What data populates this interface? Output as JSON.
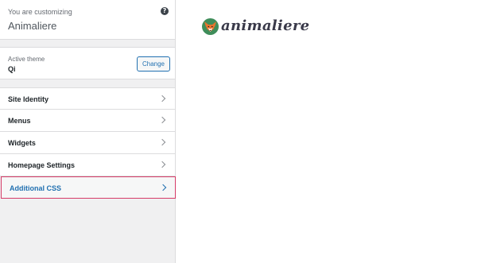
{
  "customize": {
    "action_text": "You are customizing",
    "site_title": "Animaliere",
    "help_icon_glyph": "?"
  },
  "theme": {
    "label": "Active theme",
    "name": "Qi",
    "change_label": "Change"
  },
  "menu": {
    "items": [
      {
        "label": "Site Identity"
      },
      {
        "label": "Menus"
      },
      {
        "label": "Widgets"
      },
      {
        "label": "Homepage Settings"
      },
      {
        "label": "Additional CSS",
        "active": true
      }
    ]
  },
  "preview": {
    "logo_text": "animaliere",
    "logo_icon": "fox-face-icon"
  },
  "colors": {
    "accent": "#2271b1",
    "highlight_border": "#d63c68",
    "logo_circle": "#3f8d5a"
  }
}
